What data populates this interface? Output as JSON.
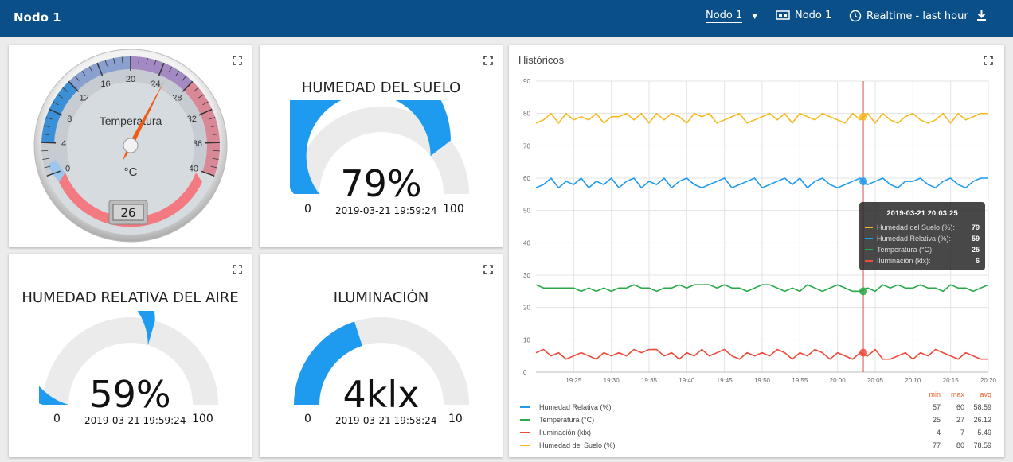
{
  "header": {
    "title": "Nodo 1",
    "selector_value": "Nodo 1",
    "device_label": "Nodo 1",
    "time_label": "Realtime - last hour"
  },
  "thermometer": {
    "caption": "Temperatura",
    "unit": "°C",
    "value": 25,
    "display": "26",
    "scale": [
      "0",
      "4",
      "8",
      "12",
      "16",
      "20",
      "24",
      "28",
      "32",
      "36",
      "40"
    ]
  },
  "soil": {
    "title": "HUMEDAD DEL SUELO",
    "value_text": "79%",
    "value": 79,
    "min": "0",
    "max": "100",
    "timestamp": "2019-03-21 19:59:24",
    "color": "#1e9bef"
  },
  "air": {
    "title": "HUMEDAD RELATIVA DEL AIRE",
    "value_text": "59%",
    "value": 59,
    "min": "0",
    "max": "100",
    "timestamp": "2019-03-21 19:59:24",
    "color": "#1e9bef"
  },
  "light": {
    "title": "ILUMINACIÓN",
    "value_text": "4klx",
    "value": 4,
    "min": "0",
    "max": "10",
    "timestamp": "2019-03-21 19:58:24",
    "color": "#1e9bef"
  },
  "history": {
    "title": "Históricos",
    "tooltip": {
      "time": "2019-03-21 20:03:25",
      "rows": [
        {
          "name": "Humedad del Suelo (%):",
          "value": "79",
          "color": "#f7b91e"
        },
        {
          "name": "Humedad Relativa (%):",
          "value": "59",
          "color": "#1e9bef"
        },
        {
          "name": "Temperatura (°C):",
          "value": "25",
          "color": "#2aa84a"
        },
        {
          "name": "Iluminación (klx):",
          "value": "6",
          "color": "#ef4b3c"
        }
      ]
    },
    "legend_headers": {
      "min": "min",
      "max": "max",
      "avg": "avg"
    },
    "legend": [
      {
        "name": "Humedad Relativa (%)",
        "min": "57",
        "max": "60",
        "avg": "58.59",
        "color": "#1e9bef"
      },
      {
        "name": "Temperatura (°C)",
        "min": "25",
        "max": "27",
        "avg": "26.12",
        "color": "#2aa84a"
      },
      {
        "name": "Iluminación (klx)",
        "min": "4",
        "max": "7",
        "avg": "5.49",
        "color": "#ef4b3c"
      },
      {
        "name": "Humedad del Suelo (%)",
        "min": "77",
        "max": "80",
        "avg": "78.59",
        "color": "#f7b91e"
      }
    ]
  },
  "chart_data": {
    "type": "line",
    "title": "Históricos",
    "ylim": [
      0,
      90
    ],
    "yticks": [
      "0",
      "10",
      "20",
      "30",
      "40",
      "50",
      "60",
      "70",
      "80",
      "90"
    ],
    "xticks": [
      "19:25",
      "19:30",
      "19:35",
      "19:40",
      "19:45",
      "19:50",
      "19:55",
      "20:00",
      "20:05",
      "20:10",
      "20:15",
      "20:20"
    ],
    "x_minutes_from_19_20": [
      0,
      1,
      2,
      3,
      4,
      5,
      6,
      7,
      8,
      9,
      10,
      11,
      12,
      13,
      14,
      15,
      16,
      17,
      18,
      19,
      20,
      21,
      22,
      23,
      24,
      25,
      26,
      27,
      28,
      29,
      30,
      31,
      32,
      33,
      34,
      35,
      36,
      37,
      38,
      39,
      40,
      41,
      42,
      43,
      44,
      45,
      46,
      47,
      48,
      49,
      50,
      51,
      52,
      53,
      54,
      55,
      56,
      57,
      58,
      59,
      60
    ],
    "cursor_time": "2019-03-21 20:03:25",
    "grid": true,
    "series": [
      {
        "name": "Humedad del Suelo (%)",
        "color": "#f7b91e",
        "values": [
          77,
          78,
          80,
          77,
          80,
          78,
          79,
          78,
          80,
          77,
          79,
          79,
          80,
          78,
          80,
          77,
          80,
          78,
          80,
          79,
          77,
          80,
          79,
          80,
          77,
          78,
          79,
          80,
          77,
          78,
          79,
          80,
          78,
          80,
          77,
          80,
          79,
          78,
          80,
          79,
          78,
          77,
          80,
          78,
          80,
          77,
          80,
          78,
          77,
          79,
          80,
          78,
          77,
          78,
          80,
          77,
          80,
          78,
          79,
          80,
          80
        ]
      },
      {
        "name": "Humedad Relativa (%)",
        "color": "#1e9bef",
        "values": [
          57,
          58,
          60,
          57,
          59,
          58,
          60,
          57,
          59,
          58,
          60,
          57,
          59,
          60,
          57,
          59,
          58,
          60,
          57,
          59,
          60,
          58,
          57,
          58,
          59,
          60,
          57,
          58,
          59,
          60,
          57,
          58,
          59,
          60,
          58,
          60,
          57,
          59,
          60,
          58,
          57,
          58,
          59,
          60,
          58,
          59,
          60,
          58,
          57,
          59,
          59,
          60,
          58,
          57,
          59,
          60,
          58,
          57,
          59,
          60,
          60
        ]
      },
      {
        "name": "Temperatura (°C)",
        "color": "#2aa84a",
        "values": [
          27,
          26,
          26,
          26,
          26,
          26,
          25,
          26,
          25,
          26,
          25,
          26,
          26,
          27,
          26,
          26,
          25,
          26,
          26,
          27,
          26,
          27,
          27,
          27,
          26,
          27,
          26,
          26,
          25,
          26,
          27,
          27,
          26,
          25,
          26,
          25,
          27,
          26,
          25,
          26,
          27,
          26,
          25,
          25,
          26,
          25,
          27,
          26,
          27,
          26,
          26,
          27,
          26,
          26,
          25,
          27,
          26,
          26,
          25,
          26,
          27
        ]
      },
      {
        "name": "Iluminación (klx)",
        "color": "#ef4b3c",
        "values": [
          6,
          7,
          5,
          6,
          4,
          5,
          6,
          5,
          4,
          6,
          5,
          6,
          5,
          7,
          6,
          7,
          7,
          5,
          6,
          4,
          6,
          5,
          7,
          5,
          6,
          7,
          5,
          4,
          6,
          5,
          6,
          5,
          7,
          6,
          4,
          6,
          5,
          7,
          6,
          4,
          6,
          5,
          4,
          6,
          5,
          7,
          4,
          4,
          5,
          6,
          4,
          6,
          5,
          7,
          6,
          5,
          4,
          6,
          5,
          4,
          4
        ]
      }
    ]
  }
}
